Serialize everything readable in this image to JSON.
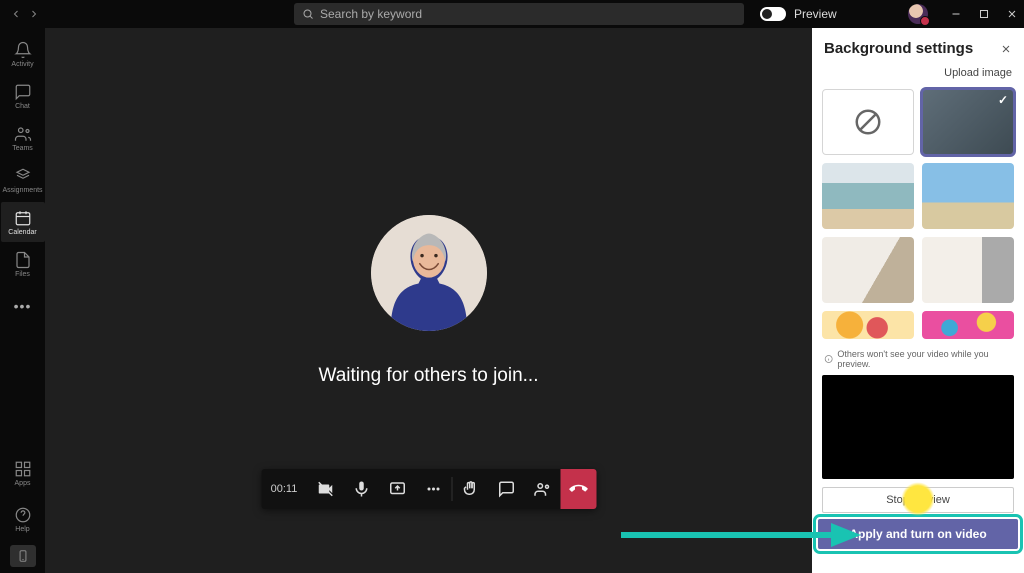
{
  "titlebar": {
    "search_placeholder": "Search by keyword",
    "preview_label": "Preview"
  },
  "sidebar": {
    "items": [
      {
        "label": "Activity"
      },
      {
        "label": "Chat"
      },
      {
        "label": "Teams"
      },
      {
        "label": "Assignments"
      },
      {
        "label": "Calendar"
      },
      {
        "label": "Files"
      }
    ],
    "apps_label": "Apps",
    "help_label": "Help"
  },
  "meeting": {
    "status_text": "Waiting for others to join...",
    "timer": "00:11"
  },
  "panel": {
    "title": "Background settings",
    "upload_label": "Upload image",
    "info_text": "Others won't see your video while you preview.",
    "stop_label": "Stop preview",
    "apply_label": "Apply and turn on video"
  }
}
